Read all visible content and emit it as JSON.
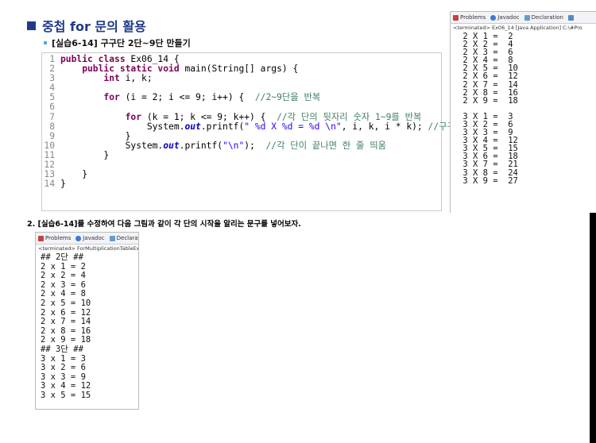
{
  "slide": {
    "title": "중첩 for 문의 활용",
    "subtitle": "[실습6-14] 구구단 2단~9단 만들기"
  },
  "code": {
    "line_numbers": [
      "1",
      "2",
      "3",
      "4",
      "5",
      "6",
      "7",
      "8",
      "9",
      "10",
      "11",
      "12",
      "13",
      "14"
    ],
    "lines": [
      {
        "segments": [
          {
            "t": "public class",
            "c": "kw"
          },
          {
            "t": " Ex06_14 {",
            "c": ""
          }
        ]
      },
      {
        "segments": [
          {
            "t": "    public static void",
            "c": "kw"
          },
          {
            "t": " main(String[] args) {",
            "c": ""
          }
        ]
      },
      {
        "segments": [
          {
            "t": "        int",
            "c": "kw"
          },
          {
            "t": " i, k;",
            "c": ""
          }
        ]
      },
      {
        "segments": []
      },
      {
        "segments": [
          {
            "t": "        for",
            "c": "kw"
          },
          {
            "t": " (i = 2; i <= 9; i++) {  ",
            "c": ""
          },
          {
            "t": "//2~9단을 반복",
            "c": "cm"
          }
        ]
      },
      {
        "segments": []
      },
      {
        "segments": [
          {
            "t": "            for",
            "c": "kw"
          },
          {
            "t": " (k = 1; k <= 9; k++) {  ",
            "c": ""
          },
          {
            "t": "//각 단의 뒷자리 숫자 1~9를 반복",
            "c": "cm"
          }
        ]
      },
      {
        "segments": [
          {
            "t": "                System.",
            "c": ""
          },
          {
            "t": "out",
            "c": "it"
          },
          {
            "t": ".printf(",
            "c": ""
          },
          {
            "t": "\" %d X %d = %d \\n\"",
            "c": "st"
          },
          {
            "t": ", i, k, i * k); ",
            "c": ""
          },
          {
            "t": "//구구단 출력",
            "c": "cm"
          }
        ]
      },
      {
        "segments": [
          {
            "t": "            }",
            "c": ""
          }
        ]
      },
      {
        "segments": [
          {
            "t": "            System.",
            "c": ""
          },
          {
            "t": "out",
            "c": "it"
          },
          {
            "t": ".printf(",
            "c": ""
          },
          {
            "t": "\"\\n\"",
            "c": "st"
          },
          {
            "t": ");  ",
            "c": ""
          },
          {
            "t": "//각 단이 끝나면 한 줄 띄움",
            "c": "cm"
          }
        ]
      },
      {
        "segments": [
          {
            "t": "        }",
            "c": ""
          }
        ]
      },
      {
        "segments": []
      },
      {
        "segments": [
          {
            "t": "    }",
            "c": ""
          }
        ]
      },
      {
        "segments": [
          {
            "t": "}",
            "c": ""
          }
        ]
      }
    ]
  },
  "console1": {
    "tabs": [
      "Problems",
      "Javadoc",
      "Declaration"
    ],
    "status": "<terminated> Ex06_14 [Java Application] C:\\#Pro",
    "lines": [
      " 2 X 1 =  2",
      " 2 X 2 =  4",
      " 2 X 3 =  6",
      " 2 X 4 =  8",
      " 2 X 5 =  10",
      " 2 X 6 =  12",
      " 2 X 7 =  14",
      " 2 X 8 =  16",
      " 2 X 9 =  18",
      "",
      " 3 X 1 =  3",
      " 3 X 2 =  6",
      " 3 X 3 =  9",
      " 3 X 4 =  12",
      " 3 X 5 =  15",
      " 3 X 6 =  18",
      " 3 X 7 =  21",
      " 3 X 8 =  24",
      " 3 X 9 =  27"
    ]
  },
  "prompt": "2. [실습6-14]를 수정하여 다음 그림과 같이 각 단의 시작을 알리는 문구를 넣어보자.",
  "console2": {
    "tabs": [
      "Problems",
      "Javadoc",
      "Declara"
    ],
    "status": "<terminated> ForMultiplicationTableEx",
    "lines": [
      "## 2단 ##",
      "2 x 1 = 2",
      "2 x 2 = 4",
      "2 x 3 = 6",
      "2 x 4 = 8",
      "2 x 5 = 10",
      "2 x 6 = 12",
      "2 x 7 = 14",
      "2 x 8 = 16",
      "2 x 9 = 18",
      "## 3단 ##",
      "3 x 1 = 3",
      "3 x 2 = 6",
      "3 x 3 = 9",
      "3 x 4 = 12",
      "3 x 5 = 15"
    ]
  },
  "colors": {
    "title": "#1f3a8a",
    "keyword": "#7f0055",
    "comment": "#3f7f5f",
    "string": "#2a00ff"
  }
}
